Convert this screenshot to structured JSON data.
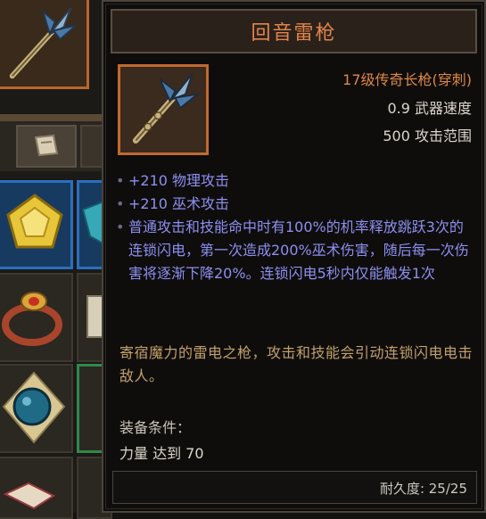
{
  "item": {
    "name": "回音雷枪",
    "type_line": "17级传奇长枪(穿刺)",
    "speed_line": "0.9  武器速度",
    "range_line": "500  攻击范围",
    "affixes": [
      "+210 物理攻击",
      "+210 巫术攻击",
      "普通攻击和技能命中时有100%的机率释放跳跃3次的连锁闪电，第一次造成200%巫术伤害，随后每一次伤害将逐渐下降20%。连锁闪电5秒内仅能触发1次"
    ],
    "flavor_text": "寄宿魔力的雷电之枪，攻击和技能会引动连锁闪电电击敌人。",
    "requirement_label": "装备条件：",
    "requirement_value": "力量 达到 70",
    "durability_text": "耐久度:  25/25",
    "icon": "trident-spear-icon"
  },
  "colors": {
    "title": "#e2844a",
    "rarity": "#dd8846",
    "affix": "#8d8ff0",
    "flavor": "#c2a06b",
    "portrait_border": "#c06a2f"
  }
}
